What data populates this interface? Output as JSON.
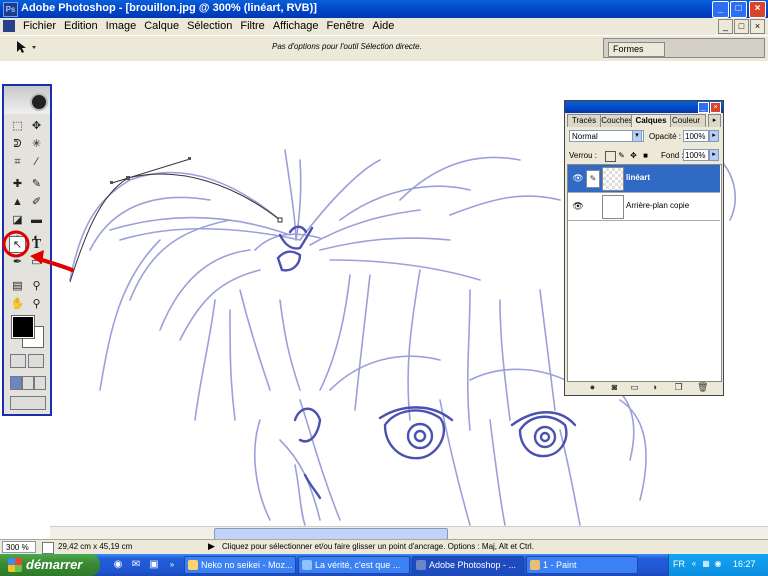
{
  "window": {
    "title": "Adobe Photoshop - [brouillon.jpg @ 300% (linéart, RVB)]",
    "app_icon_text": "Ps",
    "controls": {
      "minimize": "_",
      "maximize": "□",
      "close": "×"
    }
  },
  "menu": [
    "Fichier",
    "Edition",
    "Image",
    "Calque",
    "Sélection",
    "Filtre",
    "Affichage",
    "Fenêtre",
    "Aide"
  ],
  "options_bar": {
    "message": "Pas d'options pour l'outil Sélection directe.",
    "palette_well_tab": "Formes"
  },
  "toolbox": {
    "tools": [
      [
        "marquee-icon",
        "move-icon"
      ],
      [
        "lasso-icon",
        "magic-wand-icon"
      ],
      [
        "crop-icon",
        "slice-icon"
      ],
      [
        "healing-icon",
        "brush-icon"
      ],
      [
        "stamp-icon",
        "history-brush-icon"
      ],
      [
        "eraser-icon",
        "gradient-icon"
      ],
      [
        "blur-icon",
        "dodge-icon"
      ],
      [
        "direct-selection-icon",
        "type-icon"
      ],
      [
        "pen-icon",
        "shape-icon"
      ],
      [
        "notes-icon",
        "eyedropper-icon"
      ],
      [
        "hand-icon",
        "zoom-icon"
      ]
    ],
    "selected_tool": "direct-selection-icon",
    "type_glyph": "T",
    "foreground_color": "#000000",
    "background_color": "#ffffff"
  },
  "layers_panel": {
    "tabs": [
      "Tracés",
      "Couches",
      "Calques",
      "Couleur"
    ],
    "active_tab": "Calques",
    "blend_mode": "Normal",
    "opacity_label": "Opacité :",
    "opacity_value": "100%",
    "lock_label": "Verrou :",
    "fill_label": "Fond :",
    "fill_value": "100%",
    "layers": [
      {
        "name": "linéart",
        "active": true,
        "transparent_thumb": true
      },
      {
        "name": "Arrière-plan copie",
        "active": false,
        "transparent_thumb": false
      }
    ]
  },
  "status": {
    "zoom": "300 %",
    "doc_size": "29,42 cm x 45,19 cm",
    "message": "Cliquez pour sélectionner et/ou faire glisser un point d'ancrage. Options : Maj, Alt et Ctrl."
  },
  "taskbar": {
    "start_label": "démarrer",
    "buttons": [
      {
        "label": "Neko no seikei - Moz...",
        "active": false
      },
      {
        "label": "La vérité, c'est que ...",
        "active": false
      },
      {
        "label": "Adobe Photoshop - ...",
        "active": true
      },
      {
        "label": "1 - Paint",
        "active": false
      }
    ],
    "language": "FR",
    "clock": "16:27"
  },
  "colors": {
    "sketch": "#5860b8",
    "annotation": "#e00000",
    "selection_highlight": "#316ac5",
    "titlebar": "#0a5fd8"
  }
}
